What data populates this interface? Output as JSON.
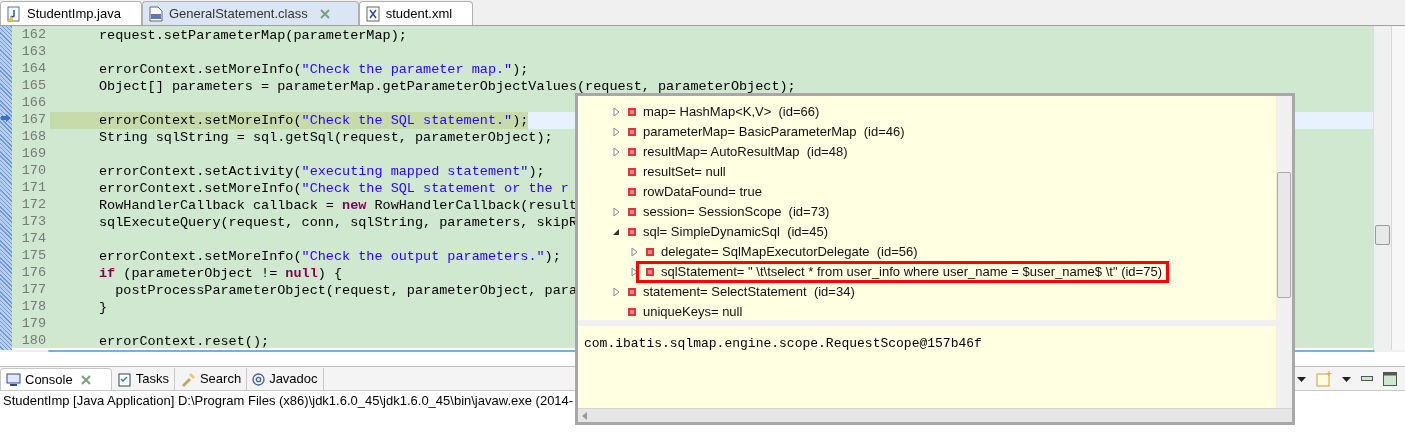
{
  "editor_tabs": [
    {
      "label": "StudentImp.java",
      "kind": "java",
      "selected": false
    },
    {
      "label": "GeneralStatement.class",
      "kind": "class",
      "selected": true
    },
    {
      "label": "student.xml",
      "kind": "xml",
      "selected": false
    }
  ],
  "editor": {
    "lines": [
      {
        "number": "162",
        "current": false,
        "tokens": [
          {
            "text": "request.setParameterMap(parameterMap);",
            "kind": "plain"
          }
        ]
      },
      {
        "number": "163",
        "current": false
      },
      {
        "number": "164",
        "current": false,
        "tokens": [
          {
            "text": "errorContext.setMoreInfo(",
            "kind": "plain"
          },
          {
            "text": "\"Check the parameter map.\"",
            "kind": "string"
          },
          {
            "text": ");",
            "kind": "plain"
          }
        ]
      },
      {
        "number": "165",
        "current": false,
        "tokens": [
          {
            "text": "Object[] parameters = parameterMap.getParameterObjectValues(request, parameterObject);",
            "kind": "plain"
          }
        ]
      },
      {
        "number": "166",
        "current": false
      },
      {
        "number": "167",
        "current": true,
        "tokens": [
          {
            "text": "errorContext.setMoreInfo(",
            "kind": "plain"
          },
          {
            "text": "\"Check the SQL statement.\"",
            "kind": "string"
          },
          {
            "text": ");",
            "kind": "plain"
          }
        ]
      },
      {
        "number": "168",
        "current": false,
        "tokens": [
          {
            "text": "String sqlString = sql.getSql(request, parameterObject);",
            "kind": "plain"
          }
        ]
      },
      {
        "number": "169",
        "current": false
      },
      {
        "number": "170",
        "current": false,
        "tokens": [
          {
            "text": "errorContext.setActivity(",
            "kind": "plain"
          },
          {
            "text": "\"executing mapped statement\"",
            "kind": "string"
          },
          {
            "text": ");",
            "kind": "plain"
          }
        ]
      },
      {
        "number": "171",
        "current": false,
        "tokens": [
          {
            "text": "errorContext.setMoreInfo(",
            "kind": "plain"
          },
          {
            "text": "\"Check the SQL statement or the r",
            "kind": "string"
          }
        ]
      },
      {
        "number": "172",
        "current": false,
        "tokens": [
          {
            "text": "RowHandlerCallback callback = ",
            "kind": "plain"
          },
          {
            "text": "new",
            "kind": "keyword"
          },
          {
            "text": " RowHandlerCallback(result",
            "kind": "plain"
          }
        ]
      },
      {
        "number": "173",
        "current": false,
        "tokens": [
          {
            "text": "sqlExecuteQuery(request, conn, sqlString, parameters, skipR",
            "kind": "plain"
          }
        ]
      },
      {
        "number": "174",
        "current": false
      },
      {
        "number": "175",
        "current": false,
        "tokens": [
          {
            "text": "errorContext.setMoreInfo(",
            "kind": "plain"
          },
          {
            "text": "\"Check the output parameters.\"",
            "kind": "string"
          },
          {
            "text": ");",
            "kind": "plain"
          }
        ]
      },
      {
        "number": "176",
        "current": false,
        "tokens": [
          {
            "text": "if",
            "kind": "keyword"
          },
          {
            "text": " (parameterObject != ",
            "kind": "plain"
          },
          {
            "text": "null",
            "kind": "keyword"
          },
          {
            "text": ") {",
            "kind": "plain"
          }
        ]
      },
      {
        "number": "177",
        "current": false,
        "tokens": [
          {
            "text": "  postProcessParameterObject(request, parameterObject, para",
            "kind": "plain"
          }
        ]
      },
      {
        "number": "178",
        "current": false,
        "tokens": [
          {
            "text": "}",
            "kind": "plain"
          }
        ]
      },
      {
        "number": "179",
        "current": false
      },
      {
        "number": "180",
        "current": false,
        "tokens": [
          {
            "text": "errorContext.reset();",
            "kind": "plain"
          }
        ]
      }
    ]
  },
  "inspector": {
    "variables": [
      {
        "label": "map= HashMap<K,V>  (id=66)",
        "kind": "object",
        "expanded": false,
        "highlighted": false
      },
      {
        "label": "parameterMap= BasicParameterMap  (id=46)",
        "kind": "object",
        "expanded": false,
        "highlighted": false
      },
      {
        "label": "resultMap= AutoResultMap  (id=48)",
        "kind": "object",
        "expanded": false,
        "highlighted": false
      },
      {
        "label": "resultSet= null",
        "kind": "value",
        "highlighted": false
      },
      {
        "label": "rowDataFound= true",
        "kind": "value",
        "highlighted": false
      },
      {
        "label": "session= SessionScope  (id=73)",
        "kind": "object",
        "expanded": false,
        "highlighted": false
      },
      {
        "label": "sql= SimpleDynamicSql  (id=45)",
        "kind": "object",
        "expanded": true,
        "highlighted": false,
        "children": [
          {
            "label": "delegate= SqlMapExecutorDelegate  (id=56)",
            "kind": "object",
            "expanded": false,
            "highlighted": false
          },
          {
            "label": "sqlStatement= \" \\t\\tselect * from user_info where user_name = $user_name$ \\t\" (id=75)",
            "kind": "object",
            "expanded": false,
            "highlighted": true
          }
        ]
      },
      {
        "label": "statement= SelectStatement  (id=34)",
        "kind": "object",
        "expanded": false,
        "highlighted": false
      },
      {
        "label": "uniqueKeys= null",
        "kind": "value",
        "highlighted": false
      }
    ],
    "detail": "com.ibatis.sqlmap.engine.scope.RequestScope@157b46f"
  },
  "bottom_tabs": [
    {
      "label": "Console",
      "kind": "console",
      "selected": true
    },
    {
      "label": "Tasks",
      "kind": "tasks",
      "selected": false
    },
    {
      "label": "Search",
      "kind": "search",
      "selected": false
    },
    {
      "label": "Javadoc",
      "kind": "javadoc",
      "selected": false
    }
  ],
  "console": {
    "title": "StudentImp [Java Application] D:\\Program Files (x86)\\jdk1.6.0_45\\jdk1.6.0_45\\bin\\javaw.exe (2014-"
  }
}
